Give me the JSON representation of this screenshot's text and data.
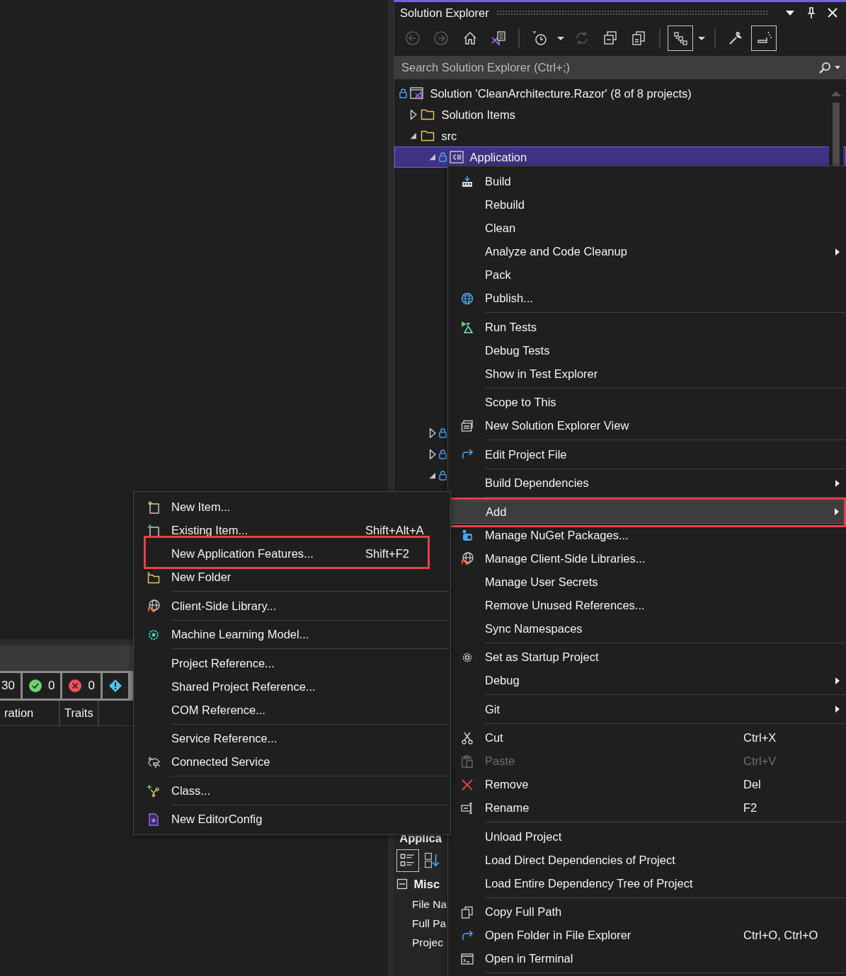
{
  "solution_explorer": {
    "title": "Solution Explorer",
    "search": {
      "placeholder": "Search Solution Explorer (Ctrl+;)"
    },
    "tree": [
      {
        "label": "Solution 'CleanArchitecture.Razor' (8 of 8 projects)",
        "kind": "solution",
        "locked": true,
        "selected": false,
        "children": [
          {
            "label": "Solution Items",
            "kind": "folder",
            "expanded": false,
            "selected": false
          },
          {
            "label": "src",
            "kind": "folder",
            "expanded": true,
            "selected": false,
            "children": [
              {
                "label": "Application",
                "kind": "project",
                "expanded": true,
                "locked": true,
                "selected": true
              },
              {
                "expanded": false,
                "locked": true,
                "selected": false
              },
              {
                "expanded": false,
                "locked": true,
                "selected": false
              },
              {
                "expanded": true,
                "locked": true,
                "selected": false
              }
            ]
          }
        ]
      }
    ]
  },
  "test_explorer": {
    "counts": [
      {
        "kind": "total",
        "label": "30"
      },
      {
        "kind": "passed",
        "label": "0"
      },
      {
        "kind": "failed",
        "label": "0"
      },
      {
        "kind": "warning"
      }
    ],
    "columns": [
      "ration",
      "Traits"
    ]
  },
  "properties": {
    "title": "Applica",
    "category": {
      "label": "Misc",
      "expanded": true
    },
    "rows": [
      "File Na",
      "Full Pa",
      "Projec"
    ]
  },
  "context_menu": [
    {
      "kind": "item",
      "label": "Build",
      "selected": false
    },
    {
      "kind": "item",
      "label": "Rebuild",
      "selected": false
    },
    {
      "kind": "item",
      "label": "Clean",
      "selected": false
    },
    {
      "kind": "item",
      "label": "Analyze and Code Cleanup",
      "submenu": true,
      "selected": false
    },
    {
      "kind": "item",
      "label": "Pack",
      "selected": false
    },
    {
      "kind": "item",
      "label": "Publish...",
      "selected": false
    },
    {
      "kind": "separator"
    },
    {
      "kind": "item",
      "label": "Run Tests",
      "selected": false
    },
    {
      "kind": "item",
      "label": "Debug Tests",
      "selected": false
    },
    {
      "kind": "item",
      "label": "Show in Test Explorer",
      "selected": false
    },
    {
      "kind": "separator"
    },
    {
      "kind": "item",
      "label": "Scope to This",
      "selected": false
    },
    {
      "kind": "item",
      "label": "New Solution Explorer View",
      "selected": false
    },
    {
      "kind": "separator"
    },
    {
      "kind": "item",
      "label": "Edit Project File",
      "selected": false
    },
    {
      "kind": "separator"
    },
    {
      "kind": "item",
      "label": "Build Dependencies",
      "submenu": true,
      "selected": false
    },
    {
      "kind": "separator"
    },
    {
      "kind": "item",
      "label": "Add",
      "submenu": true,
      "selected": true,
      "highlighted": true
    },
    {
      "kind": "item",
      "label": "Manage NuGet Packages...",
      "selected": false
    },
    {
      "kind": "item",
      "label": "Manage Client-Side Libraries...",
      "selected": false
    },
    {
      "kind": "item",
      "label": "Manage User Secrets",
      "selected": false
    },
    {
      "kind": "item",
      "label": "Remove Unused References...",
      "selected": false
    },
    {
      "kind": "item",
      "label": "Sync Namespaces",
      "selected": false
    },
    {
      "kind": "separator"
    },
    {
      "kind": "item",
      "label": "Set as Startup Project",
      "selected": false
    },
    {
      "kind": "item",
      "label": "Debug",
      "submenu": true,
      "selected": false
    },
    {
      "kind": "separator"
    },
    {
      "kind": "item",
      "label": "Git",
      "submenu": true,
      "selected": false
    },
    {
      "kind": "separator"
    },
    {
      "kind": "item",
      "label": "Cut",
      "shortcut": "Ctrl+X",
      "selected": false
    },
    {
      "kind": "item",
      "label": "Paste",
      "shortcut": "Ctrl+V",
      "disabled": true,
      "selected": false
    },
    {
      "kind": "item",
      "label": "Remove",
      "shortcut": "Del",
      "selected": false
    },
    {
      "kind": "item",
      "label": "Rename",
      "shortcut": "F2",
      "selected": false
    },
    {
      "kind": "separator"
    },
    {
      "kind": "item",
      "label": "Unload Project",
      "selected": false
    },
    {
      "kind": "item",
      "label": "Load Direct Dependencies of Project",
      "selected": false
    },
    {
      "kind": "item",
      "label": "Load Entire Dependency Tree of Project",
      "selected": false
    },
    {
      "kind": "separator"
    },
    {
      "kind": "item",
      "label": "Copy Full Path",
      "selected": false
    },
    {
      "kind": "item",
      "label": "Open Folder in File Explorer",
      "shortcut": "Ctrl+O, Ctrl+O",
      "selected": false
    },
    {
      "kind": "item",
      "label": "Open in Terminal",
      "selected": false
    },
    {
      "kind": "separator"
    }
  ],
  "add_submenu": [
    {
      "kind": "item",
      "label": "New Item...",
      "selected": false
    },
    {
      "kind": "item",
      "label": "Existing Item...",
      "shortcut": "Shift+Alt+A",
      "selected": false
    },
    {
      "kind": "item",
      "label": "New Application Features...",
      "shortcut": "Shift+F2",
      "selected": false,
      "highlighted": true
    },
    {
      "kind": "item",
      "label": "New Folder",
      "selected": false
    },
    {
      "kind": "separator"
    },
    {
      "kind": "item",
      "label": "Client-Side Library...",
      "selected": false
    },
    {
      "kind": "separator"
    },
    {
      "kind": "item",
      "label": "Machine Learning Model...",
      "selected": false
    },
    {
      "kind": "separator"
    },
    {
      "kind": "item",
      "label": "Project Reference...",
      "selected": false
    },
    {
      "kind": "item",
      "label": "Shared Project Reference...",
      "selected": false
    },
    {
      "kind": "item",
      "label": "COM Reference...",
      "selected": false
    },
    {
      "kind": "separator"
    },
    {
      "kind": "item",
      "label": "Service Reference...",
      "selected": false
    },
    {
      "kind": "item",
      "label": "Connected Service",
      "selected": false
    },
    {
      "kind": "separator"
    },
    {
      "kind": "item",
      "label": "Class...",
      "selected": false
    },
    {
      "kind": "separator"
    },
    {
      "kind": "item",
      "label": "New EditorConfig",
      "selected": false
    }
  ]
}
